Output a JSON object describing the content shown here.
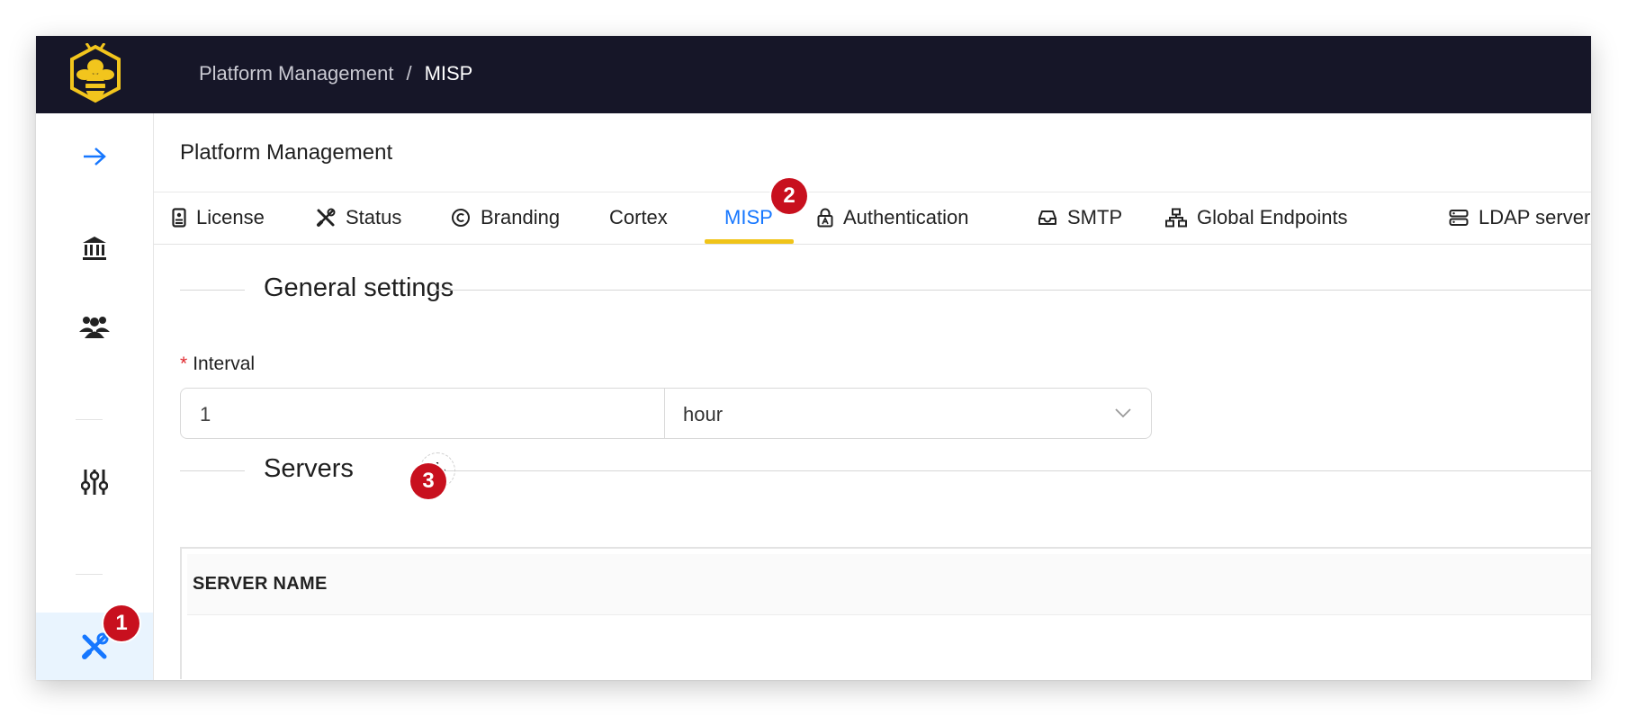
{
  "breadcrumb": {
    "parent": "Platform Management",
    "separator": "/",
    "current": "MISP"
  },
  "page": {
    "title": "Platform Management"
  },
  "tabs": [
    {
      "label": "License",
      "icon": "license-icon"
    },
    {
      "label": "Status",
      "icon": "tools-icon"
    },
    {
      "label": "Branding",
      "icon": "copyright-icon"
    },
    {
      "label": "Cortex",
      "icon": ""
    },
    {
      "label": "MISP",
      "icon": "",
      "active": true
    },
    {
      "label": "Authentication",
      "icon": "lock-icon"
    },
    {
      "label": "SMTP",
      "icon": "inbox-icon"
    },
    {
      "label": "Global Endpoints",
      "icon": "network-icon"
    },
    {
      "label": "LDAP servers",
      "icon": "database-icon"
    }
  ],
  "general": {
    "section_title": "General settings",
    "interval_label": "Interval",
    "required_mark": "*",
    "interval_value": "1",
    "unit_value": "hour"
  },
  "servers": {
    "section_title": "Servers",
    "columns": [
      "SERVER NAME"
    ]
  },
  "badges": [
    "1",
    "2",
    "3"
  ],
  "colors": {
    "topbar": "#161628",
    "accent": "#1677ff",
    "tab_ink": "#f0c419",
    "badge": "#c8101e",
    "logo": "#f2c51d"
  }
}
